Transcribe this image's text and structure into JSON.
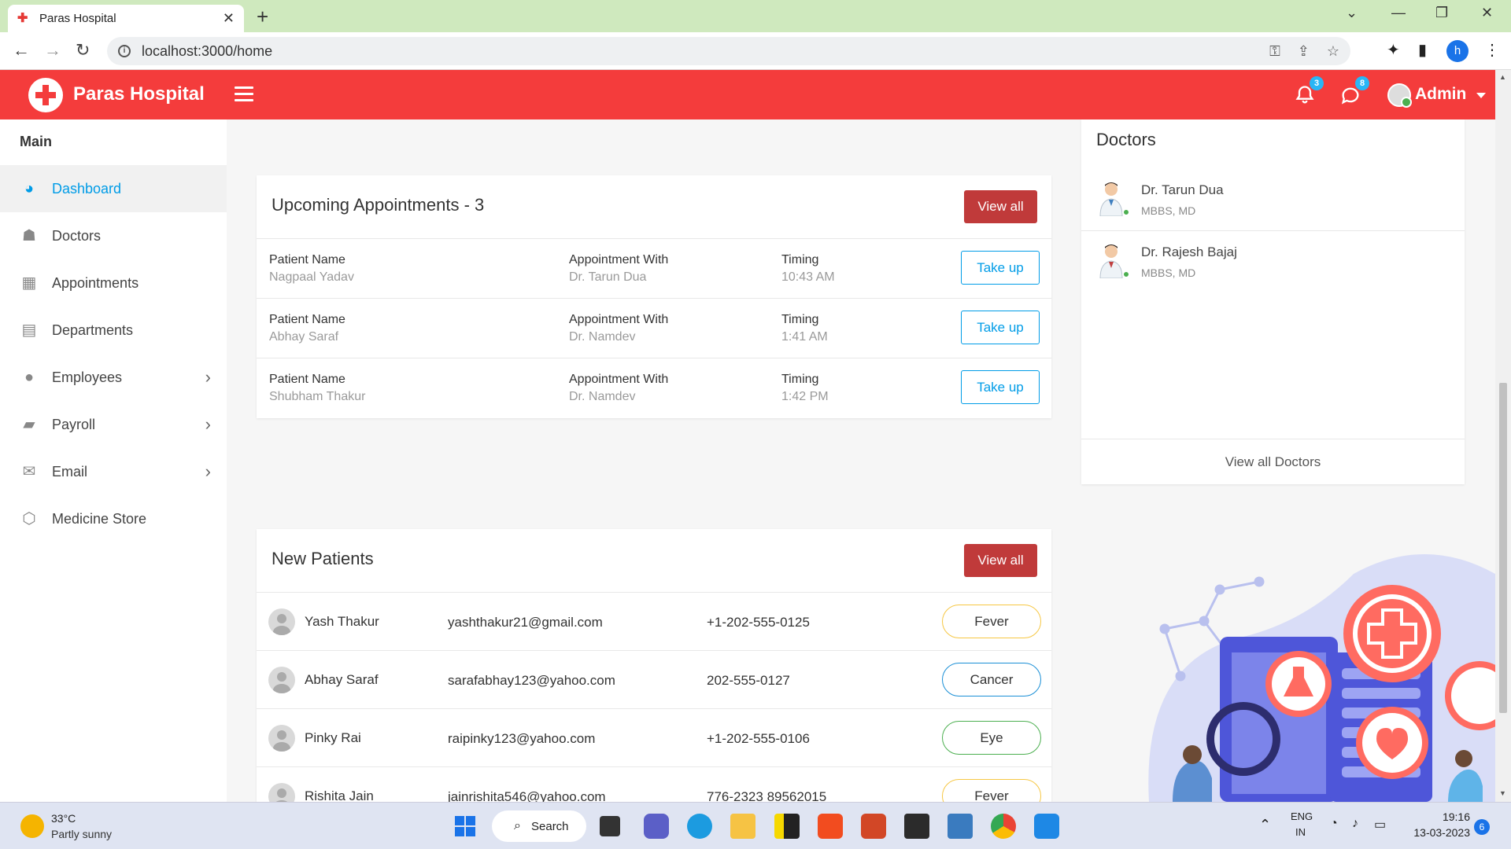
{
  "browser": {
    "tab_title": "Paras Hospital",
    "url": "localhost:3000/home",
    "profile_initial": "h"
  },
  "header": {
    "brand": "Paras Hospital",
    "notifications_count": "3",
    "messages_count": "8",
    "user_label": "Admin"
  },
  "sidebar": {
    "section_title": "Main",
    "items": [
      {
        "label": "Dashboard",
        "icon": "dashboard-icon",
        "active": true
      },
      {
        "label": "Doctors",
        "icon": "doctor-icon"
      },
      {
        "label": "Appointments",
        "icon": "calendar-icon"
      },
      {
        "label": "Departments",
        "icon": "hospital-icon"
      },
      {
        "label": "Employees",
        "icon": "user-icon",
        "submenu": true
      },
      {
        "label": "Payroll",
        "icon": "book-icon",
        "submenu": true
      },
      {
        "label": "Email",
        "icon": "envelope-icon",
        "submenu": true
      },
      {
        "label": "Medicine Store",
        "icon": "box-icon"
      }
    ]
  },
  "appointments": {
    "title": "Upcoming Appointments - 3",
    "view_all": "View all",
    "col_patient": "Patient Name",
    "col_with": "Appointment With",
    "col_timing": "Timing",
    "action_label": "Take up",
    "rows": [
      {
        "patient": "Nagpaal Yadav",
        "doctor": "Dr. Tarun Dua",
        "time": "10:43 AM"
      },
      {
        "patient": "Abhay Saraf",
        "doctor": "Dr. Namdev",
        "time": "1:41 AM"
      },
      {
        "patient": "Shubham Thakur",
        "doctor": "Dr. Namdev",
        "time": "1:42 PM"
      }
    ]
  },
  "patients": {
    "title": "New Patients",
    "view_all": "View all",
    "rows": [
      {
        "name": "Yash Thakur",
        "email": "yashthakur21@gmail.com",
        "phone": "+1-202-555-0125",
        "condition": "Fever",
        "color": "#f6c744"
      },
      {
        "name": "Abhay Saraf",
        "email": "sarafabhay123@yahoo.com",
        "phone": "202-555-0127",
        "condition": "Cancer",
        "color": "#1a8fd6"
      },
      {
        "name": "Pinky Rai",
        "email": "raipinky123@yahoo.com",
        "phone": "+1-202-555-0106",
        "condition": "Eye",
        "color": "#4caf50"
      },
      {
        "name": "Rishita Jain",
        "email": "jainrishita546@yahoo.com",
        "phone": "776-2323 89562015",
        "condition": "Fever",
        "color": "#f6c744"
      }
    ]
  },
  "doctors": {
    "title": "Doctors",
    "footer_link": "View all Doctors",
    "items": [
      {
        "name": "Dr. Tarun Dua",
        "degree": "MBBS, MD"
      },
      {
        "name": "Dr. Rajesh Bajaj",
        "degree": "MBBS, MD"
      }
    ]
  },
  "taskbar": {
    "temperature": "33°C",
    "weather": "Partly sunny",
    "search_label": "Search",
    "language_line1": "ENG",
    "language_line2": "IN",
    "time": "19:16",
    "date": "13-03-2023",
    "notification_count": "6"
  },
  "colors": {
    "header_red": "#f43c3c",
    "accent_blue": "#009ce7",
    "button_red": "#c03a3a"
  }
}
